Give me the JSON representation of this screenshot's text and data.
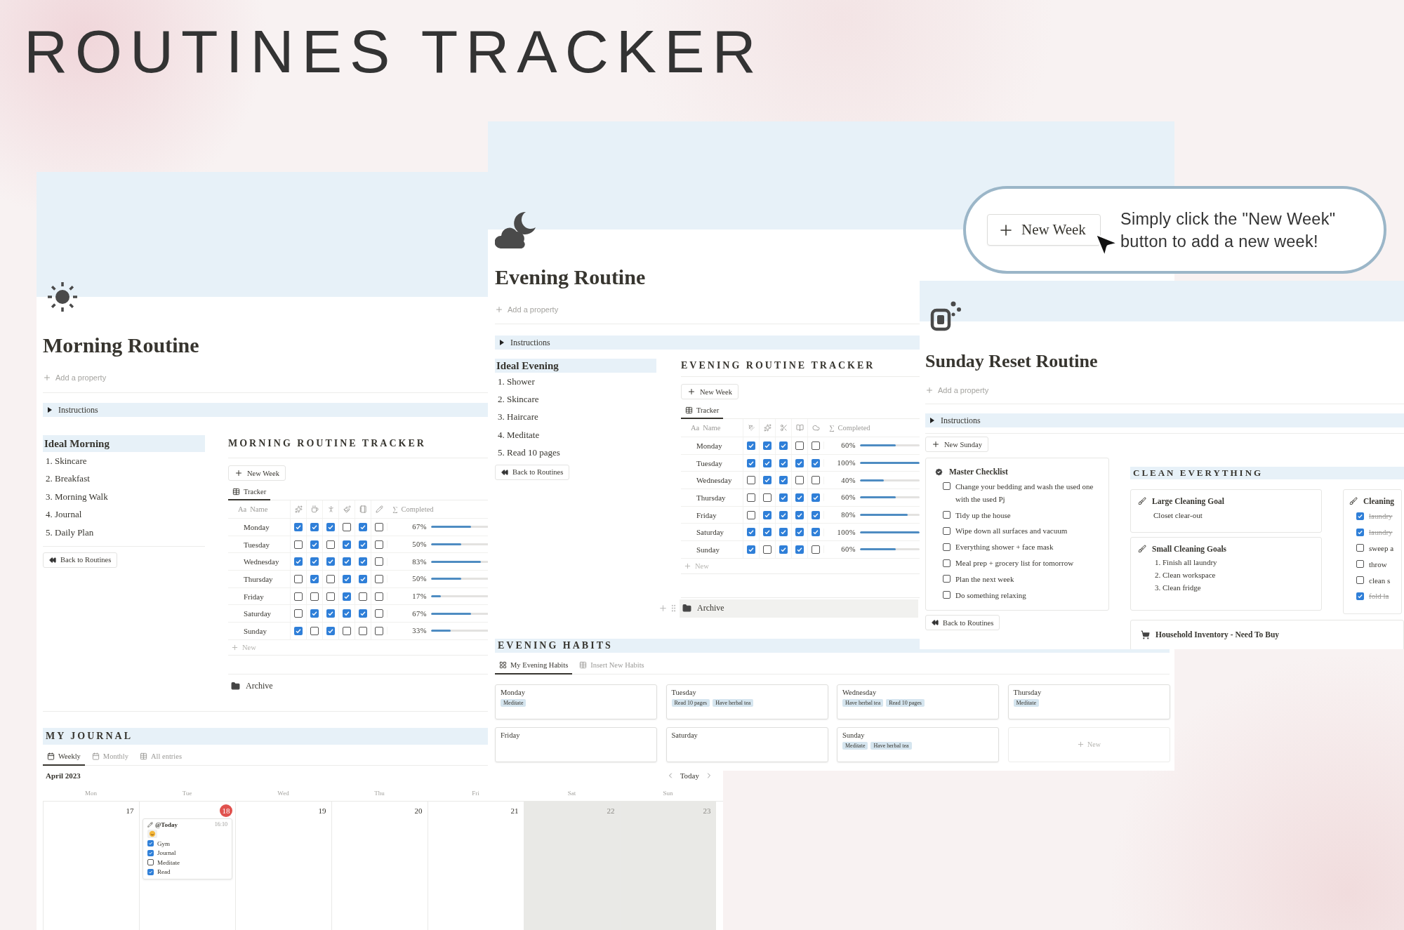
{
  "page_title": "ROUTINES TRACKER",
  "morning_routine": {
    "title": "Morning Routine",
    "add_property": "Add a property",
    "instructions": {
      "label": "Instructions",
      "expanded": false
    },
    "ideal": {
      "heading": "Ideal Morning",
      "items": [
        {
          "number": "1.",
          "text": "Skincare"
        },
        {
          "number": "2.",
          "text": "Breakfast"
        },
        {
          "number": "3.",
          "text": "Morning Walk"
        },
        {
          "number": "4.",
          "text": "Journal"
        },
        {
          "number": "5.",
          "text": "Daily Plan"
        }
      ]
    },
    "back_button": "Back to Routines",
    "tracker": {
      "heading": "MORNING ROUTINE TRACKER",
      "new_button": "New Week",
      "tabs": [
        {
          "label": "Tracker",
          "selected": true
        }
      ],
      "name_header": {
        "symbol": "Aa",
        "label": "Name"
      },
      "completed_header": {
        "symbol": "∑",
        "label": "Completed"
      },
      "rows": [
        {
          "name": "Monday",
          "checks": [
            true,
            true,
            true,
            false,
            true,
            false
          ],
          "percent": "67%",
          "level": 0.67
        },
        {
          "name": "Tuesday",
          "checks": [
            false,
            true,
            false,
            true,
            true,
            false
          ],
          "percent": "50%",
          "level": 0.5
        },
        {
          "name": "Wednesday",
          "checks": [
            true,
            true,
            true,
            true,
            true,
            false
          ],
          "percent": "83%",
          "level": 0.83
        },
        {
          "name": "Thursday",
          "checks": [
            false,
            true,
            false,
            true,
            true,
            false
          ],
          "percent": "50%",
          "level": 0.5
        },
        {
          "name": "Friday",
          "checks": [
            false,
            false,
            false,
            true,
            false,
            false
          ],
          "percent": "17%",
          "level": 0.17
        },
        {
          "name": "Saturday",
          "checks": [
            false,
            true,
            true,
            true,
            true,
            false
          ],
          "percent": "67%",
          "level": 0.67
        },
        {
          "name": "Sunday",
          "checks": [
            true,
            false,
            true,
            false,
            false,
            false
          ],
          "percent": "33%",
          "level": 0.33
        }
      ],
      "new_row": "New"
    },
    "archive": "Archive"
  },
  "journal": {
    "heading": "MY JOURNAL",
    "tabs": [
      {
        "label": "Weekly",
        "selected": true
      },
      {
        "label": "Monthly",
        "selected": false
      },
      {
        "label": "All entries",
        "selected": false
      }
    ],
    "month": "April 2023",
    "today_button": "Today",
    "days": [
      {
        "weekday": "Mon",
        "date": "17",
        "today": false,
        "weekend": false
      },
      {
        "weekday": "Tue",
        "date": "18",
        "today": true,
        "weekend": false,
        "entries": [
          {
            "title": "@Today",
            "time": "16:10",
            "checklist": [
              {
                "label": "Gym",
                "checked": true
              },
              {
                "label": "Journal",
                "checked": true
              },
              {
                "label": "Meditate",
                "checked": false
              },
              {
                "label": "Read",
                "checked": true
              }
            ]
          }
        ]
      },
      {
        "weekday": "Wed",
        "date": "19",
        "today": false,
        "weekend": false
      },
      {
        "weekday": "Thu",
        "date": "20",
        "today": false,
        "weekend": false
      },
      {
        "weekday": "Fri",
        "date": "21",
        "today": false,
        "weekend": false
      },
      {
        "weekday": "Sat",
        "date": "22",
        "today": false,
        "weekend": true
      },
      {
        "weekday": "Sun",
        "date": "23",
        "today": false,
        "weekend": true
      }
    ]
  },
  "evening_routine": {
    "title": "Evening Routine",
    "add_property": "Add a property",
    "instructions": {
      "label": "Instructions",
      "expanded": false
    },
    "ideal": {
      "heading": "Ideal Evening",
      "items": [
        {
          "number": "1.",
          "text": "Shower"
        },
        {
          "number": "2.",
          "text": "Skincare"
        },
        {
          "number": "3.",
          "text": "Haircare"
        },
        {
          "number": "4.",
          "text": "Meditate"
        },
        {
          "number": "5.",
          "text": "Read 10 pages"
        }
      ]
    },
    "back_button": "Back to Routines",
    "tracker": {
      "heading": "EVENING ROUTINE TRACKER",
      "new_button": "New Week",
      "tabs": [
        {
          "label": "Tracker",
          "selected": true
        }
      ],
      "name_header": {
        "symbol": "Aa",
        "label": "Name"
      },
      "completed_header": {
        "symbol": "∑",
        "label": "Completed"
      },
      "rows": [
        {
          "name": "Monday",
          "checks": [
            true,
            true,
            true,
            false,
            false
          ],
          "percent": "60%",
          "level": 0.6
        },
        {
          "name": "Tuesday",
          "checks": [
            true,
            true,
            true,
            true,
            true
          ],
          "percent": "100%",
          "level": 1
        },
        {
          "name": "Wednesday",
          "checks": [
            false,
            true,
            true,
            false,
            false
          ],
          "percent": "40%",
          "level": 0.4
        },
        {
          "name": "Thursday",
          "checks": [
            false,
            false,
            true,
            true,
            true
          ],
          "percent": "60%",
          "level": 0.6
        },
        {
          "name": "Friday",
          "checks": [
            false,
            true,
            true,
            true,
            true
          ],
          "percent": "80%",
          "level": 0.8
        },
        {
          "name": "Saturday",
          "checks": [
            true,
            true,
            true,
            true,
            true
          ],
          "percent": "100%",
          "level": 1
        },
        {
          "name": "Sunday",
          "checks": [
            true,
            false,
            true,
            true,
            false
          ],
          "percent": "60%",
          "level": 0.6
        }
      ],
      "new_row": "New"
    },
    "archive": "Archive",
    "habits": {
      "heading": "EVENING HABITS",
      "tabs": [
        {
          "label": "My Evening Habits",
          "selected": true
        },
        {
          "label": "Insert New Habits",
          "selected": false
        }
      ],
      "cards": [
        {
          "day": "Monday",
          "tags": [
            "Meditate"
          ]
        },
        {
          "day": "Tuesday",
          "tags": [
            "Read 10 pages",
            "Have herbal tea"
          ]
        },
        {
          "day": "Wednesday",
          "tags": [
            "Have herbal tea",
            "Read 10 pages"
          ]
        },
        {
          "day": "Thursday",
          "tags": [
            "Meditate"
          ]
        },
        {
          "day": "Friday"
        },
        {
          "day": "Saturday"
        },
        {
          "day": "Sunday",
          "tags": [
            "Meditate",
            "Have herbal tea"
          ]
        }
      ],
      "new_card": "New"
    }
  },
  "callout": {
    "button": "New Week",
    "text": "Simply click the \"New Week\" button to add a new week!"
  },
  "sunday_reset_routine": {
    "title": "Sunday Reset Routine",
    "add_property": "Add a property",
    "instructions": {
      "label": "Instructions",
      "expanded": false
    },
    "new_button": "New Sunday",
    "master_checklist": {
      "title": "Master Checklist",
      "items": [
        {
          "text": "Change your bedding and wash the used one with the used Pj",
          "checked": false
        },
        {
          "text": "Tidy up the house",
          "checked": false
        },
        {
          "text": "Wipe down all surfaces and vacuum",
          "checked": false
        },
        {
          "text": "Everything shower + face mask",
          "checked": false
        },
        {
          "text": "Meal prep + grocery list for tomorrow",
          "checked": false
        },
        {
          "text": "Plan the next week",
          "checked": false
        },
        {
          "text": "Do something relaxing",
          "checked": false
        }
      ]
    },
    "back_button": "Back to Routines",
    "clean_everything": {
      "heading": "CLEAN EVERYTHING",
      "large_goal": {
        "title": "Large Cleaning Goal",
        "text": "Closet clear-out"
      },
      "small_goals": {
        "title": "Small Cleaning Goals",
        "items": [
          {
            "number": "1.",
            "text": "Finish all laundry"
          },
          {
            "number": "2.",
            "text": "Clean workspace"
          },
          {
            "number": "3.",
            "text": "Clean fridge"
          }
        ]
      },
      "cleaning_card": {
        "title": "Cleaning",
        "items": [
          {
            "text": "laundry",
            "checked": true
          },
          {
            "text": "laundry",
            "checked": true
          },
          {
            "text": "sweep a",
            "checked": false
          },
          {
            "text": "throw",
            "checked": false
          },
          {
            "text": "clean s",
            "checked": false
          },
          {
            "text": "fold la",
            "checked": true
          }
        ]
      }
    },
    "inventory": "Household Inventory - Need To Buy"
  }
}
